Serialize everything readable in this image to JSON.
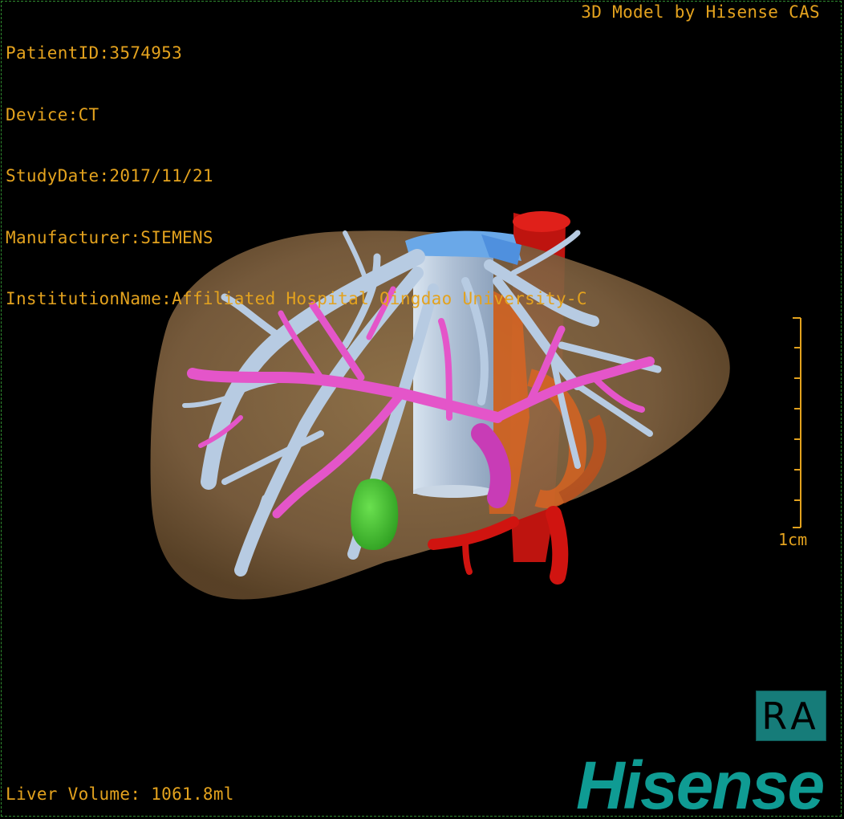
{
  "patient_info": {
    "patient_id": "PatientID:3574953",
    "device": "Device:CT",
    "study_date": "StudyDate:2017/11/21",
    "manufacturer": "Manufacturer:SIEMENS",
    "institution": "InstitutionName:Affiliated Hospital Qingdao University-C"
  },
  "credit": "3D Model by Hisense CAS",
  "liver_volume": "Liver Volume: 1061.8ml",
  "scale_bar": {
    "label": "1cm"
  },
  "orientation_label": "RA",
  "brand_logo": "Hisense",
  "colors": {
    "overlay_text": "#e3a21e",
    "liver": "#8a6a42",
    "hepatic_vein": "#b7cbe2",
    "portal_vein": "#e455c9",
    "artery": "#d01410",
    "gallbladder": "#3fbf2d",
    "ivc_top": "#6aa8e8",
    "brand": "#0f9b93"
  }
}
